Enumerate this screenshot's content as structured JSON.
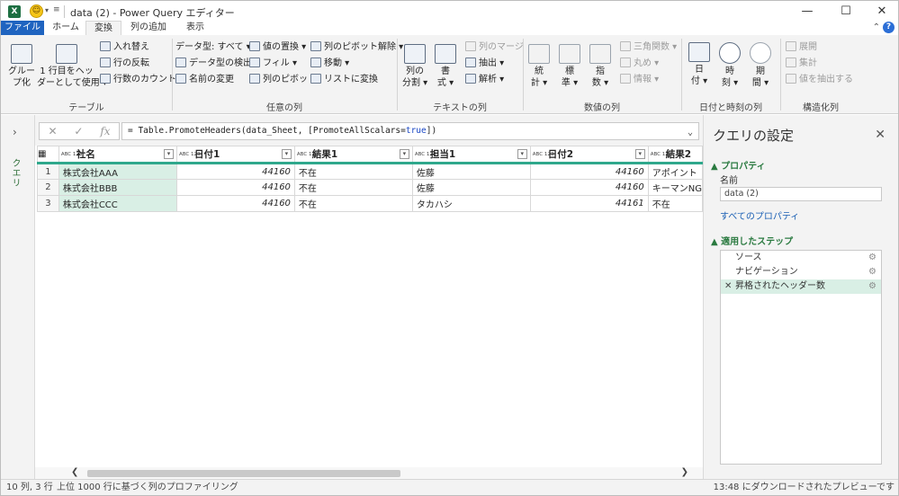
{
  "titlebar": {
    "app_icon": "X",
    "title": "data (2) - Power Query エディター",
    "minimize": "—",
    "maximize": "☐",
    "close": "✕"
  },
  "tabs": {
    "file": "ファイル",
    "home": "ホーム",
    "transform": "変換",
    "add_column": "列の追加",
    "view": "表示",
    "help": "?"
  },
  "ribbon": {
    "table": {
      "group_label": "テーブル",
      "group_by_1": "グルー",
      "group_by_2": "プ化",
      "promote_1": "1 行目をヘッ",
      "promote_2": "ダーとして使用 ▾",
      "transpose": "入れ替え",
      "reverse": "行の反転",
      "count_rows": "行数のカウント"
    },
    "any_column": {
      "group_label": "任意の列",
      "data_type": "データ型: すべて ▾",
      "detect_type": "データ型の検出",
      "rename": "名前の変更",
      "replace": "値の置換 ▾",
      "fill": "フィル ▾",
      "pivot": "列のピボット",
      "unpivot": "列のピボット解除 ▾",
      "move": "移動 ▾",
      "to_list": "リストに変換"
    },
    "text_column": {
      "group_label": "テキストの列",
      "split_1": "列の",
      "split_2": "分割 ▾",
      "format_1": "書",
      "format_2": "式 ▾",
      "merge": "列のマージ",
      "extract": "抽出 ▾",
      "parse": "解析 ▾"
    },
    "number_column": {
      "group_label": "数値の列",
      "stats_1": "統",
      "stats_2": "計 ▾",
      "standard_1": "標",
      "standard_2": "準 ▾",
      "sci_1": "指",
      "sci_2": "数 ▾",
      "trig": "三角関数 ▾",
      "rounding": "丸め ▾",
      "info": "情報 ▾"
    },
    "datetime_column": {
      "group_label": "日付と時刻の列",
      "date_1": "日",
      "date_2": "付 ▾",
      "time_1": "時",
      "time_2": "刻 ▾",
      "duration_1": "期",
      "duration_2": "間 ▾"
    },
    "structured_column": {
      "group_label": "構造化列",
      "expand": "展開",
      "aggregate": "集計",
      "extract_values": "値を抽出する"
    }
  },
  "leftpane": {
    "label": "クエリ",
    "arrow": "›"
  },
  "formula": {
    "cancel": "✕",
    "confirm": "✓",
    "fx": "fx",
    "prefix": "= Table.PromoteHeaders(data_Sheet, [PromoteAllScalars=",
    "keyword": "true",
    "suffix": "])",
    "expand": "⌄"
  },
  "grid": {
    "type_badge": "ABC 123",
    "columns": [
      "社名",
      "日付1",
      "結果1",
      "担当1",
      "日付2",
      "結果2"
    ],
    "rows": [
      {
        "n": "1",
        "cells": [
          "株式会社AAA",
          "44160",
          "不在",
          "佐藤",
          "44160",
          "アポイント"
        ]
      },
      {
        "n": "2",
        "cells": [
          "株式会社BBB",
          "44160",
          "不在",
          "佐藤",
          "44160",
          "キーマンNG"
        ]
      },
      {
        "n": "3",
        "cells": [
          "株式会社CCC",
          "44160",
          "不在",
          "タカハシ",
          "44161",
          "不在"
        ]
      }
    ]
  },
  "scroll": {
    "left": "❮",
    "right": "❯"
  },
  "settings": {
    "title": "クエリの設定",
    "close": "✕",
    "properties": "▲ プロパティ",
    "name_label": "名前",
    "name_value": "data (2)",
    "all_properties": "すべてのプロパティ",
    "applied_steps": "▲ 適用したステップ",
    "steps": [
      {
        "label": "ソース",
        "active": false
      },
      {
        "label": "ナビゲーション",
        "active": false
      },
      {
        "label": "昇格されたヘッダー数",
        "active": true
      }
    ]
  },
  "status": {
    "size": "10 列, 3 行",
    "profiling": "上位 1000 行に基づく列のプロファイリング",
    "download": "13:48 にダウンロードされたプレビューです"
  }
}
